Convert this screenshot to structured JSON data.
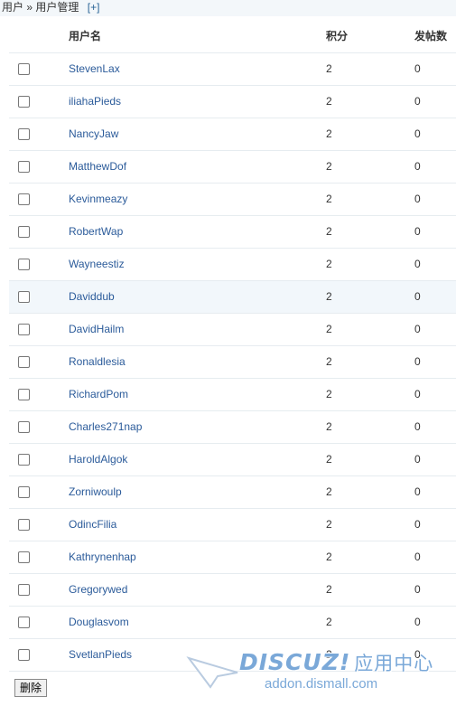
{
  "breadcrumb": {
    "root": "用户",
    "separator": "»",
    "current": "用户管理",
    "add_link": "[+]"
  },
  "table": {
    "headers": [
      "用户名",
      "积分",
      "发帖数"
    ],
    "highlight_row": 7,
    "rows": [
      {
        "username": "StevenLax",
        "points": "2",
        "posts": "0"
      },
      {
        "username": "iliahaPieds",
        "points": "2",
        "posts": "0"
      },
      {
        "username": "NancyJaw",
        "points": "2",
        "posts": "0"
      },
      {
        "username": "MatthewDof",
        "points": "2",
        "posts": "0"
      },
      {
        "username": "Kevinmeazy",
        "points": "2",
        "posts": "0"
      },
      {
        "username": "RobertWap",
        "points": "2",
        "posts": "0"
      },
      {
        "username": "Wayneestiz",
        "points": "2",
        "posts": "0"
      },
      {
        "username": "Daviddub",
        "points": "2",
        "posts": "0"
      },
      {
        "username": "DavidHailm",
        "points": "2",
        "posts": "0"
      },
      {
        "username": "Ronaldlesia",
        "points": "2",
        "posts": "0"
      },
      {
        "username": "RichardPom",
        "points": "2",
        "posts": "0"
      },
      {
        "username": "Charles271nap",
        "points": "2",
        "posts": "0"
      },
      {
        "username": "HaroldAlgok",
        "points": "2",
        "posts": "0"
      },
      {
        "username": "Zorniwoulp",
        "points": "2",
        "posts": "0"
      },
      {
        "username": "OdincFilia",
        "points": "2",
        "posts": "0"
      },
      {
        "username": "Kathrynenhap",
        "points": "2",
        "posts": "0"
      },
      {
        "username": "Gregorywed",
        "points": "2",
        "posts": "0"
      },
      {
        "username": "Douglasvom",
        "points": "2",
        "posts": "0"
      },
      {
        "username": "SvetlanPieds",
        "points": "2",
        "posts": "0"
      }
    ]
  },
  "actions": {
    "delete_label": "删除"
  },
  "watermark": {
    "brand": "DISCUZ!",
    "brand_cn": "应用中心",
    "domain": "addon.dismall.com"
  },
  "colors": {
    "link": "#2b5b9a",
    "header_bg": "#f3f7fa",
    "row_highlight": "#f2f7fb",
    "watermark": "#7aa8d8"
  }
}
